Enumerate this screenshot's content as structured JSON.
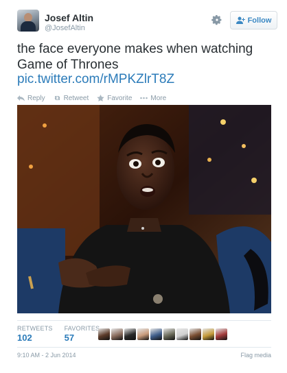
{
  "tweet": {
    "author": {
      "fullname": "Josef Altin",
      "username": "@JosefAltin"
    },
    "follow_label": "Follow",
    "text": "the face everyone makes when watching Game of Thrones",
    "link": "pic.twitter.com/rMPKZlrT8Z",
    "actions": {
      "reply": "Reply",
      "retweet": "Retweet",
      "favorite": "Favorite",
      "more": "More"
    },
    "stats": {
      "retweets_label": "RETWEETS",
      "retweets_count": "102",
      "favorites_label": "FAVORITES",
      "favorites_count": "57"
    },
    "favoriter_avatar_colors": [
      "#5c3b2a",
      "#8a6d5e",
      "#2a2a2a",
      "#c89a7a",
      "#3f5d8a",
      "#6b6b5a",
      "#d0d0d0",
      "#7a4e32",
      "#c49a3a",
      "#a33c3c"
    ],
    "timestamp": "9:10 AM - 2 Jun 2014",
    "flag_label": "Flag media"
  },
  "colors": {
    "link": "#2b7bb9",
    "muted": "#8899a6",
    "text": "#292f33"
  },
  "icons": [
    "gear-icon",
    "follow-person-icon",
    "reply-icon",
    "retweet-icon",
    "favorite-star-icon",
    "more-dots-icon"
  ]
}
